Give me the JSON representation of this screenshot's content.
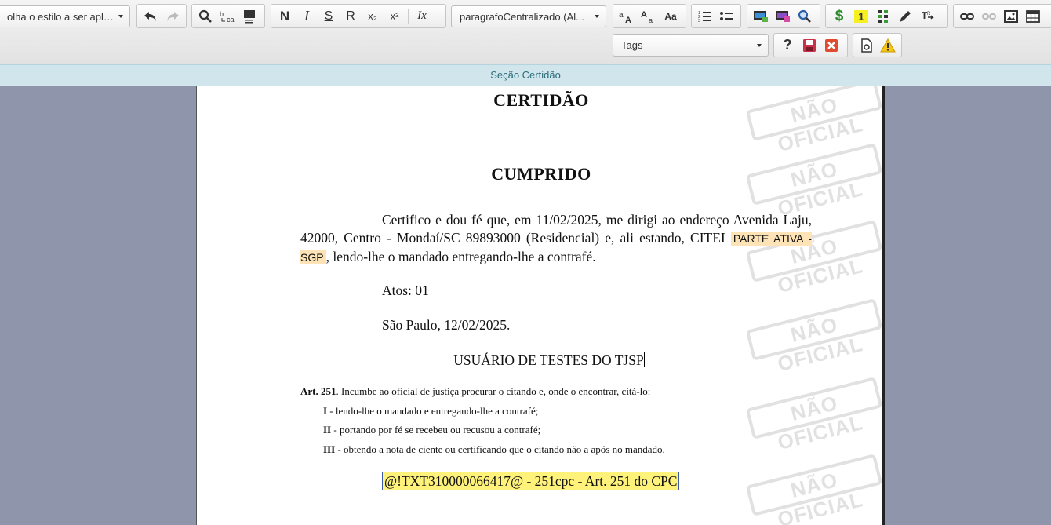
{
  "toolbar": {
    "style_select": "olha o estilo a ser apli...",
    "paragraph_select": "paragrafoCentralizado (Al...",
    "tags_select": "Tags",
    "bold_label": "N",
    "italic_label": "I",
    "underline_label": "S",
    "strike_label": "R",
    "subscript_label": "x₂",
    "superscript_label": "x²",
    "clear_format_label": "Ix",
    "font_size_label": "Aa",
    "highlight_label": "1"
  },
  "section": {
    "title": "Seção Certidão"
  },
  "watermark": {
    "text": "NÃO OFICIAL"
  },
  "document": {
    "title": "CERTIDÃO",
    "subtitle": "CUMPRIDO",
    "body_before": "Certifico e dou fé que, em 11/02/2025, me dirigi ao endereço Avenida Laju, 42000, Centro - Mondaí/SC 89893000 (Residencial) e, ali estando, CITEI",
    "party_tag": "PARTE ATIVA - SGP",
    "body_after": ", lendo-lhe o mandado entregando-lhe a contrafé.",
    "acts": "Atos: 01",
    "place_date": "São Paulo, 12/02/2025.",
    "signer": "USUÁRIO DE TESTES DO TJSP",
    "article_ref": "Art. 251",
    "article_text": ". Incumbe ao oficial de justiça procurar o citando e, onde o encontrar, citá-lo:",
    "items": [
      {
        "num": "I",
        "text": " - lendo-lhe o mandado e entregando-lhe a contrafé;"
      },
      {
        "num": "II",
        "text": " - portando por fé se recebeu ou recusou a contrafé;"
      },
      {
        "num": "III",
        "text": " - obtendo a nota de ciente ou certificando que o citando não a após no mandado."
      }
    ],
    "template_code": "@!TXT310000066417@ - 251cpc - Art. 251 do CPC"
  },
  "colors": {
    "section_bar": "#d1e6ec",
    "backdrop": "#8f95ab",
    "highlight_tag": "#fde3b5",
    "code_highlight": "#fff27a",
    "watermark": "#e1e1e1"
  }
}
